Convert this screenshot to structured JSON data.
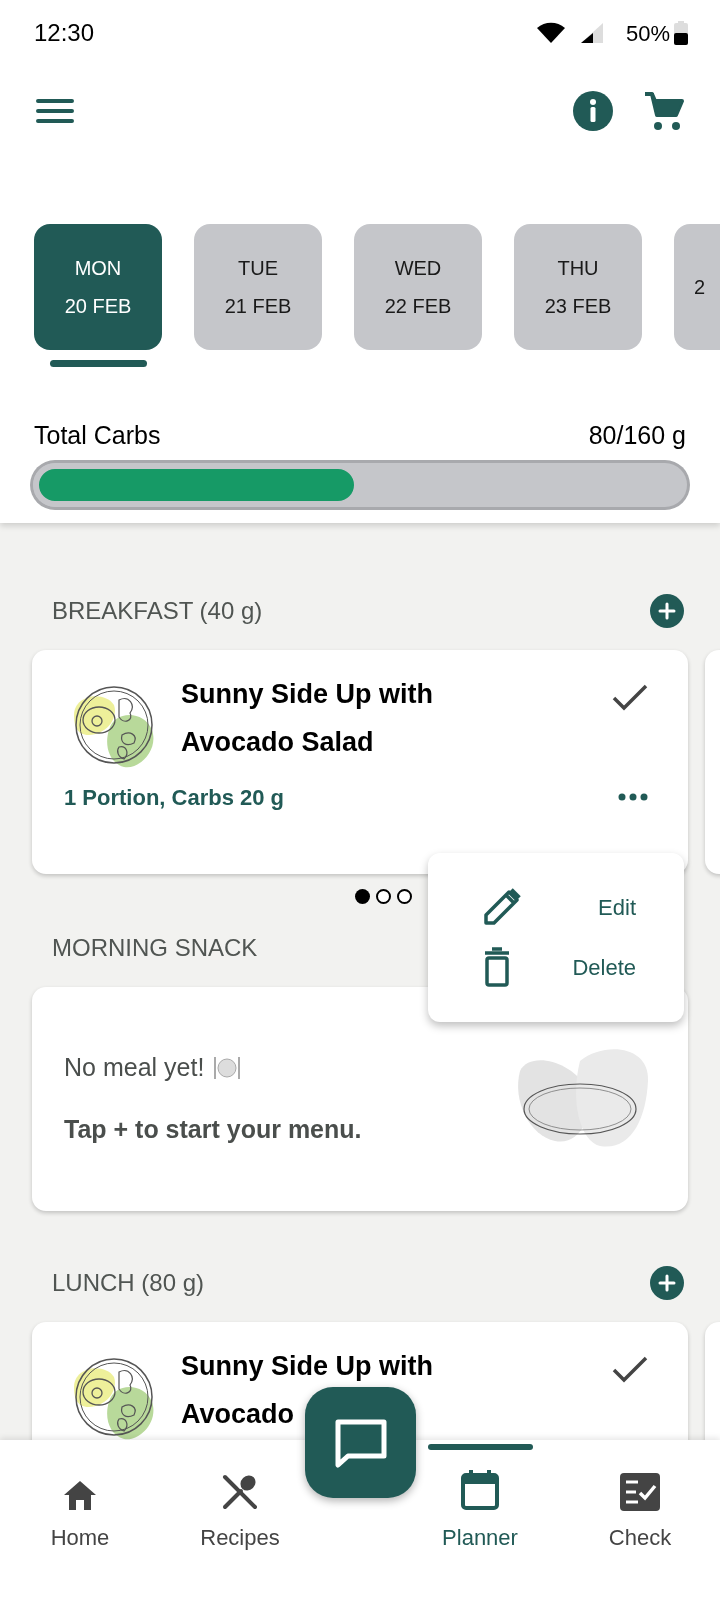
{
  "status_bar": {
    "time": "12:30",
    "battery": "50%"
  },
  "days": [
    {
      "day": "MON",
      "date": "20 FEB",
      "selected": true
    },
    {
      "day": "TUE",
      "date": "21 FEB",
      "selected": false
    },
    {
      "day": "WED",
      "date": "22 FEB",
      "selected": false
    },
    {
      "day": "THU",
      "date": "23 FEB",
      "selected": false
    },
    {
      "date": "2",
      "selected": false
    }
  ],
  "carbs": {
    "label": "Total Carbs",
    "reading": "80/160 g",
    "level": 0.5
  },
  "meals": [
    {
      "kind": "recipe",
      "title": "BREAKFAST (40 g)",
      "add": true,
      "name_lines": [
        "Sunny Side Up with",
        "Avocado Salad"
      ],
      "detail": "1 Portion, Carbs 20 g",
      "pages": [
        {
          "selected": true
        },
        {
          "selected": false
        },
        {
          "selected": false
        }
      ]
    },
    {
      "kind": "empty",
      "title": "MORNING SNACK",
      "add": false,
      "line_1": "No meal yet!",
      "line_2": "Tap + to start your menu."
    },
    {
      "kind": "recipe",
      "title": "LUNCH (80 g)",
      "add": true,
      "name_lines": [
        "Sunny Side Up with",
        "Avocado"
      ]
    }
  ],
  "menu": [
    {
      "kind": "edit",
      "label": "Edit"
    },
    {
      "kind": "delete",
      "label": "Delete"
    }
  ],
  "nav": [
    {
      "kind": "home",
      "label": "Home",
      "selected": false
    },
    {
      "kind": "recipes",
      "label": "Recipes",
      "selected": false
    },
    {
      "kind": "planner",
      "label": "Planner",
      "selected": true
    },
    {
      "kind": "check",
      "label": "Check",
      "selected": false
    }
  ]
}
